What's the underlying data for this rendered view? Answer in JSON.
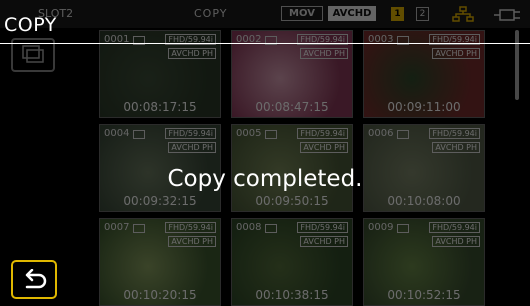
{
  "topbar": {
    "slot": "SLOT2",
    "mode": "COPY",
    "formats": [
      "MOV",
      "AVCHD"
    ],
    "cards": [
      "1",
      "2"
    ]
  },
  "clips": [
    {
      "num": "0001",
      "badge1": "FHD/59.94i",
      "badge2": "AVCHD PH",
      "time": "00:08:17:15"
    },
    {
      "num": "0002",
      "badge1": "FHD/59.94i",
      "badge2": "AVCHD PH",
      "time": "00:08:47:15"
    },
    {
      "num": "0003",
      "badge1": "FHD/59.94i",
      "badge2": "AVCHD PH",
      "time": "00:09:11:00"
    },
    {
      "num": "0004",
      "badge1": "FHD/59.94i",
      "badge2": "AVCHD PH",
      "time": "00:09:32:15"
    },
    {
      "num": "0005",
      "badge1": "FHD/59.94i",
      "badge2": "AVCHD PH",
      "time": "00:09:50:15"
    },
    {
      "num": "0006",
      "badge1": "FHD/59.94i",
      "badge2": "AVCHD PH",
      "time": "00:10:08:00"
    },
    {
      "num": "0007",
      "badge1": "FHD/59.94i",
      "badge2": "AVCHD PH",
      "time": "00:10:20:15"
    },
    {
      "num": "0008",
      "badge1": "FHD/59.94i",
      "badge2": "AVCHD PH",
      "time": "00:10:38:15"
    },
    {
      "num": "0009",
      "badge1": "FHD/59.94i",
      "badge2": "AVCHD PH",
      "time": "00:10:52:15"
    }
  ],
  "overlay": {
    "title": "COPY",
    "message": "Copy completed."
  },
  "icons": {
    "back": "return-arrow-icon",
    "network": "network-icon",
    "battery": "battery-icon",
    "copy": "copy-icon"
  }
}
